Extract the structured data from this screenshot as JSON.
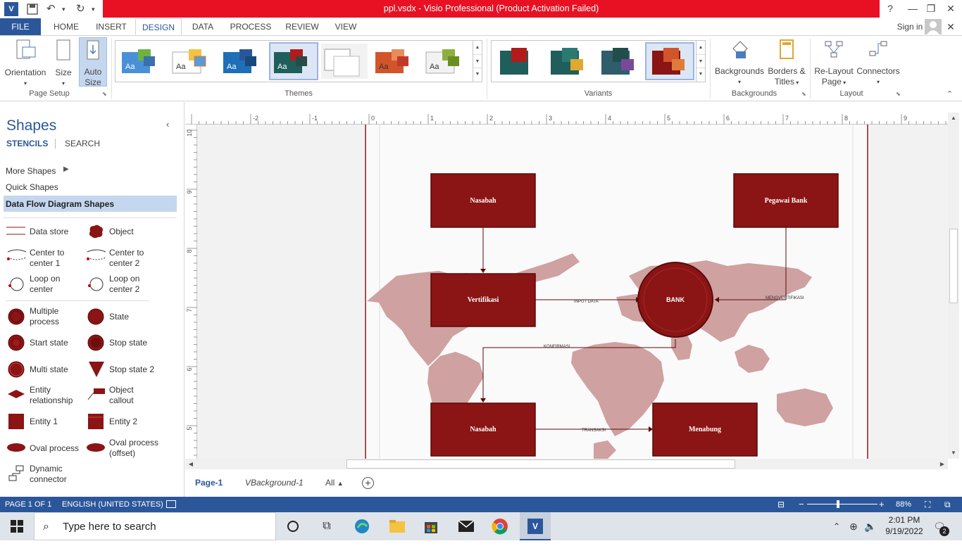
{
  "window": {
    "title": "ppl.vsdx - Visio Professional (Product Activation Failed)",
    "help": "?",
    "sign_in": "Sign in"
  },
  "tabs": [
    "FILE",
    "HOME",
    "INSERT",
    "DESIGN",
    "DATA",
    "PROCESS",
    "REVIEW",
    "VIEW"
  ],
  "active_tab": "DESIGN",
  "ribbon": {
    "page_setup": {
      "orientation": "Orientation",
      "size": "Size",
      "auto_size_1": "Auto",
      "auto_size_2": "Size",
      "label": "Page Setup"
    },
    "themes": {
      "label": "Themes",
      "thumb_text": "Aa"
    },
    "variants": {
      "label": "Variants"
    },
    "backgrounds": {
      "backgrounds": "Backgrounds",
      "borders_1": "Borders &",
      "borders_2": "Titles",
      "label": "Backgrounds"
    },
    "layout": {
      "relayout_1": "Re-Layout",
      "relayout_2": "Page",
      "connectors": "Connectors",
      "label": "Layout"
    }
  },
  "shapes_pane": {
    "title": "Shapes",
    "tab_stencils": "STENCILS",
    "tab_search": "SEARCH",
    "more_shapes": "More Shapes",
    "quick_shapes": "Quick Shapes",
    "stencil": "Data Flow Diagram Shapes",
    "items": [
      {
        "l1": "Data store",
        "l2": ""
      },
      {
        "l1": "Object",
        "l2": ""
      },
      {
        "l1": "Center to",
        "l2": "center 1"
      },
      {
        "l1": "Center to",
        "l2": "center 2"
      },
      {
        "l1": "Loop on",
        "l2": "center"
      },
      {
        "l1": "Loop on",
        "l2": "center 2"
      },
      {
        "l1": "Multiple",
        "l2": "process"
      },
      {
        "l1": "State",
        "l2": ""
      },
      {
        "l1": "Start state",
        "l2": ""
      },
      {
        "l1": "Stop state",
        "l2": ""
      },
      {
        "l1": "Multi state",
        "l2": ""
      },
      {
        "l1": "Stop state 2",
        "l2": ""
      },
      {
        "l1": "Entity",
        "l2": "relationship"
      },
      {
        "l1": "Object",
        "l2": "callout"
      },
      {
        "l1": "Entity 1",
        "l2": ""
      },
      {
        "l1": "Entity 2",
        "l2": ""
      },
      {
        "l1": "Oval process",
        "l2": ""
      },
      {
        "l1": "Oval process",
        "l2": "(offset)"
      },
      {
        "l1": "Dynamic",
        "l2": "connector"
      }
    ]
  },
  "ruler": {
    "h": [
      "-2",
      "-1",
      "0",
      "1",
      "2",
      "3",
      "4",
      "5",
      "6",
      "7",
      "8",
      "9"
    ],
    "v": [
      "10",
      "9",
      "8",
      "7",
      "6",
      "5"
    ]
  },
  "diagram": {
    "nasabah_top": "Nasabah",
    "pegawai": "Pegawai Bank",
    "verifikasi": "Vertifikasi",
    "bank": "BANK",
    "nasabah_bottom": "Nasabah",
    "menabung": "Menabung",
    "lbl_input": "INPUT DATA",
    "lbl_menverifikasi": "MENGVERTIFIKASI",
    "lbl_konfirmasi": "KONFIRMASI",
    "lbl_transaksi": "TRANSAKSI"
  },
  "page_tabs": {
    "page1": "Page-1",
    "vbackground": "VBackground-1",
    "all": "All"
  },
  "status": {
    "page": "PAGE 1 OF 1",
    "language": "ENGLISH (UNITED STATES)",
    "zoom": "88%"
  },
  "taskbar": {
    "search_placeholder": "Type here to search",
    "time": "2:01 PM",
    "date": "9/19/2022",
    "notif_count": "2"
  },
  "colors": {
    "accent": "#2b579a",
    "titlebar_red": "#e81123",
    "shape_fill": "#8b1414",
    "map": "#cfa1a1"
  }
}
